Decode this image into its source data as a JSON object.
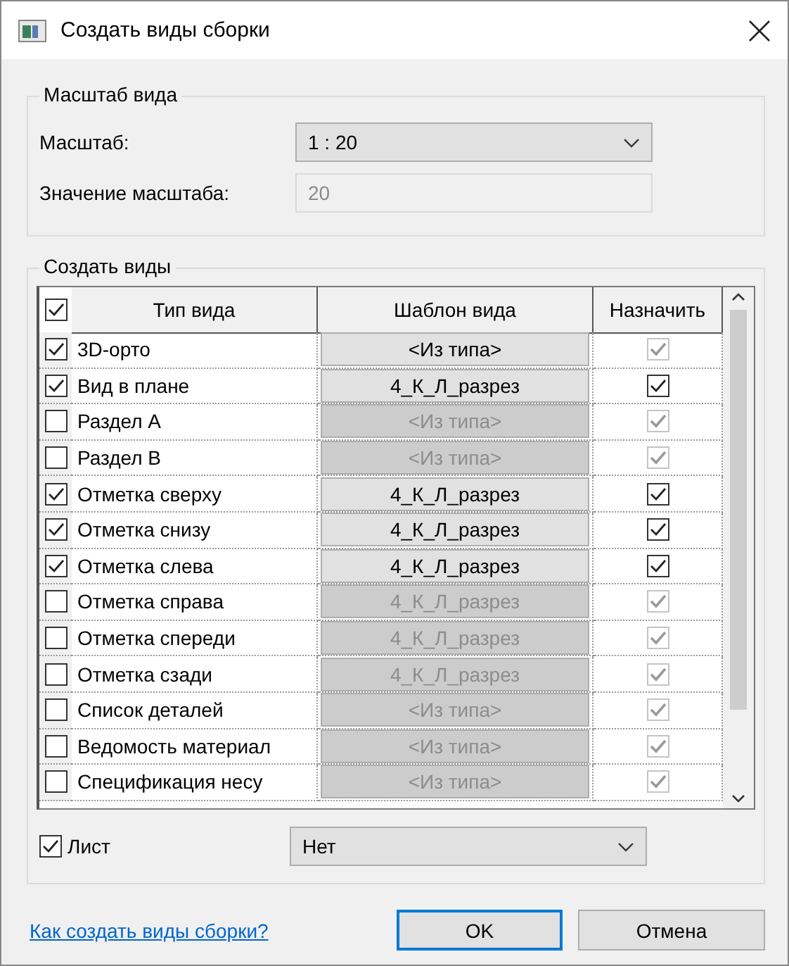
{
  "window": {
    "title": "Создать виды сборки"
  },
  "scale_group": {
    "title": "Масштаб вида",
    "scale_label": "Масштаб:",
    "scale_value": "1 : 20",
    "value_label": "Значение масштаба:",
    "value_field": "20",
    "value_disabled": true
  },
  "views_group": {
    "title": "Создать виды",
    "table": {
      "all_checked": true,
      "columns": [
        "Тип вида",
        "Шаблон вида",
        "Назначить"
      ],
      "rows": [
        {
          "name": "3D-орто",
          "checked": true,
          "template": "<Из типа>",
          "template_disabled": false,
          "assign": true,
          "assign_disabled": true
        },
        {
          "name": "Вид в плане",
          "checked": true,
          "template": "4_К_Л_разрез",
          "template_disabled": false,
          "assign": true,
          "assign_disabled": false
        },
        {
          "name": "Раздел А",
          "checked": false,
          "template": "<Из типа>",
          "template_disabled": true,
          "assign": true,
          "assign_disabled": true
        },
        {
          "name": "Раздел В",
          "checked": false,
          "template": "<Из типа>",
          "template_disabled": true,
          "assign": true,
          "assign_disabled": true
        },
        {
          "name": "Отметка сверху",
          "checked": true,
          "template": "4_К_Л_разрез",
          "template_disabled": false,
          "assign": true,
          "assign_disabled": false
        },
        {
          "name": "Отметка снизу",
          "checked": true,
          "template": "4_К_Л_разрез",
          "template_disabled": false,
          "assign": true,
          "assign_disabled": false
        },
        {
          "name": "Отметка слева",
          "checked": true,
          "template": "4_К_Л_разрез",
          "template_disabled": false,
          "assign": true,
          "assign_disabled": false
        },
        {
          "name": "Отметка справа",
          "checked": false,
          "template": "4_К_Л_разрез",
          "template_disabled": true,
          "assign": true,
          "assign_disabled": true
        },
        {
          "name": "Отметка спереди",
          "checked": false,
          "template": "4_К_Л_разрез",
          "template_disabled": true,
          "assign": true,
          "assign_disabled": true
        },
        {
          "name": "Отметка сзади",
          "checked": false,
          "template": "4_К_Л_разрез",
          "template_disabled": true,
          "assign": true,
          "assign_disabled": true
        },
        {
          "name": "Список деталей",
          "checked": false,
          "template": "<Из типа>",
          "template_disabled": true,
          "assign": true,
          "assign_disabled": true
        },
        {
          "name": "Ведомость материал",
          "checked": false,
          "template": "<Из типа>",
          "template_disabled": true,
          "assign": true,
          "assign_disabled": true
        },
        {
          "name": "Спецификация несу",
          "checked": false,
          "template": "<Из типа>",
          "template_disabled": true,
          "assign": true,
          "assign_disabled": true
        }
      ]
    },
    "sheet": {
      "label": "Лист",
      "checked": true,
      "value": "Нет"
    }
  },
  "help_link": "Как создать виды сборки?",
  "buttons": [
    {
      "label": "OK",
      "default": true
    },
    {
      "label": "Отмена",
      "default": false
    }
  ]
}
